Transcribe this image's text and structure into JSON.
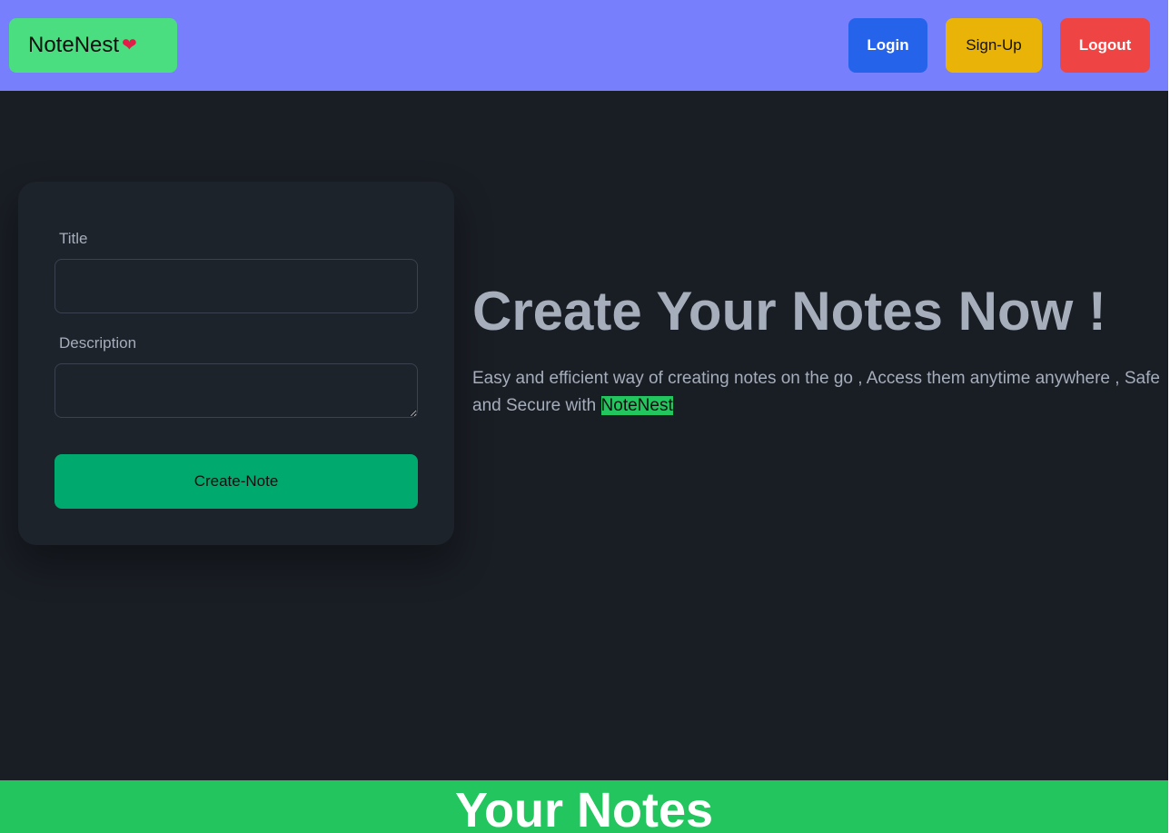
{
  "navbar": {
    "brand": "NoteNest",
    "brand_icon": "heart-icon",
    "login_label": "Login",
    "signup_label": "Sign-Up",
    "logout_label": "Logout"
  },
  "form": {
    "title_label": "Title",
    "title_value": "",
    "description_label": "Description",
    "description_value": "",
    "submit_label": "Create-Note"
  },
  "hero": {
    "heading": "Create Your Notes Now !",
    "text": "Easy and efficient way of creating notes on the go , Access them anytime anywhere , Safe and Secure with ",
    "highlight": "NoteNest"
  },
  "notes_section": {
    "heading": "Your Notes"
  },
  "colors": {
    "navbar": "#787ffd",
    "brand": "#4ade80",
    "login": "#2563eb",
    "signup": "#eab308",
    "logout": "#ef4444",
    "background": "#191d24",
    "card": "#1d232a",
    "create_button": "#00a96e",
    "notes_bar": "#22c55e"
  }
}
